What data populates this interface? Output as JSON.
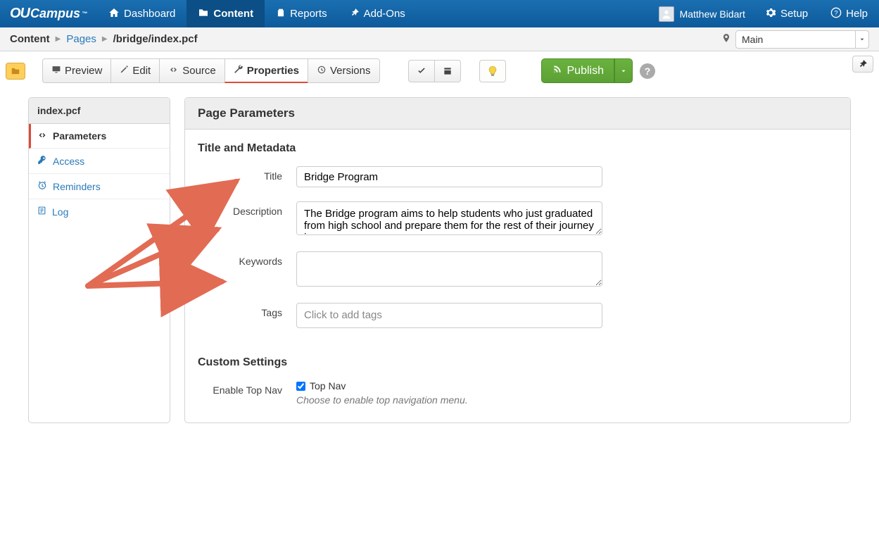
{
  "brand": {
    "prefix": "OU",
    "suffix": "Campus",
    "tm": "™"
  },
  "topnav": {
    "dashboard": "Dashboard",
    "content": "Content",
    "reports": "Reports",
    "addons": "Add-Ons",
    "user": "Matthew Bidart",
    "setup": "Setup",
    "help": "Help"
  },
  "crumbs": {
    "root": "Content",
    "pages": "Pages",
    "path": "/bridge/index.pcf",
    "site": "Main"
  },
  "tabs": {
    "preview": "Preview",
    "edit": "Edit",
    "source": "Source",
    "properties": "Properties",
    "versions": "Versions"
  },
  "publish": {
    "label": "Publish"
  },
  "sidebar": {
    "header": "index.pcf",
    "items": {
      "parameters": "Parameters",
      "access": "Access",
      "reminders": "Reminders",
      "log": "Log"
    }
  },
  "panel": {
    "header": "Page Parameters",
    "section_meta": "Title and Metadata",
    "labels": {
      "title": "Title",
      "description": "Description",
      "keywords": "Keywords",
      "tags": "Tags"
    },
    "values": {
      "title": "Bridge Program",
      "description": "The Bridge program aims to help students who just graduated from high school and prepare them for the rest of their journey in",
      "keywords": "",
      "tags_placeholder": "Click to add tags"
    },
    "section_custom": "Custom Settings",
    "custom": {
      "topnav_label": "Enable Top Nav",
      "topnav_cklabel": "Top Nav",
      "topnav_help": "Choose to enable top navigation menu."
    }
  }
}
